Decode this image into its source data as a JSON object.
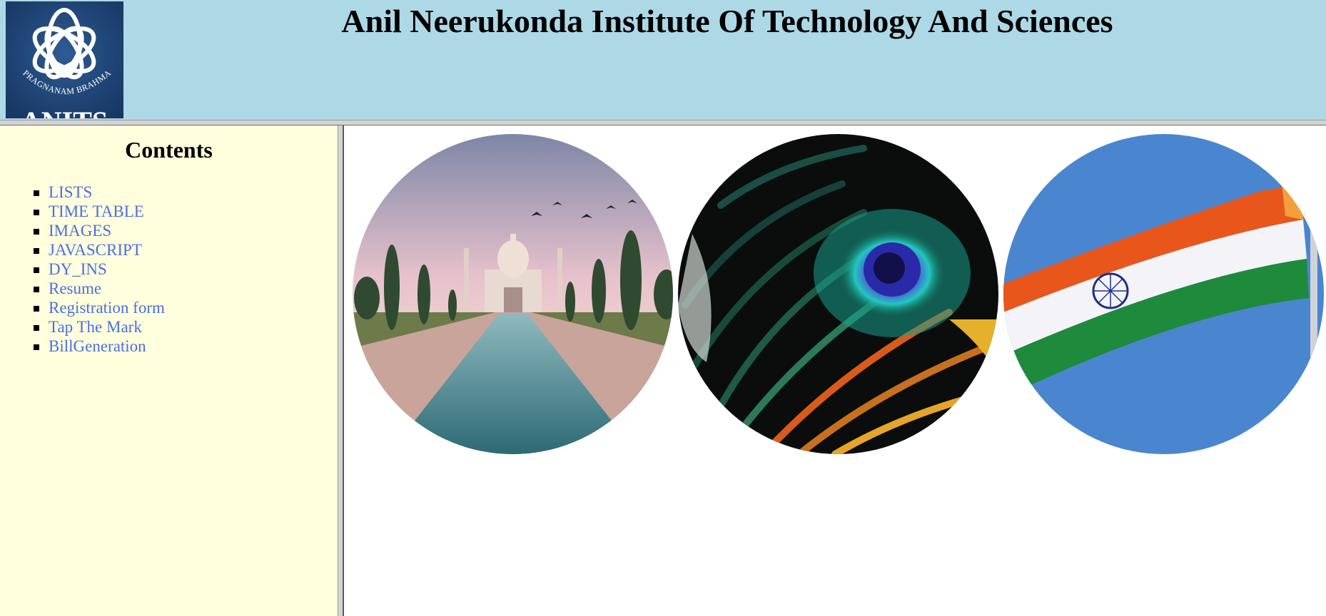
{
  "header": {
    "title": "Anil Neerukonda Institute Of Technology And Sciences",
    "logo": {
      "motto": "PRAGNANAM BRAHMA",
      "name": "ANITS",
      "icon": "anits-logo-icon",
      "background_color": "#1c3f6e"
    },
    "background_color": "#add8e6"
  },
  "nav": {
    "heading": "Contents",
    "background_color": "#ffffdd",
    "link_color": "#4a6fe0",
    "items": [
      {
        "label": "LISTS"
      },
      {
        "label": "TIME TABLE"
      },
      {
        "label": "IMAGES"
      },
      {
        "label": "JAVASCRIPT"
      },
      {
        "label": "DY_INS"
      },
      {
        "label": "Resume"
      },
      {
        "label": "Registration form"
      },
      {
        "label": "Tap The Mark"
      },
      {
        "label": "BillGeneration"
      }
    ]
  },
  "main": {
    "images": [
      {
        "subject": "taj-mahal-image"
      },
      {
        "subject": "peacock-feather-image"
      },
      {
        "subject": "indian-flag-image"
      }
    ]
  }
}
